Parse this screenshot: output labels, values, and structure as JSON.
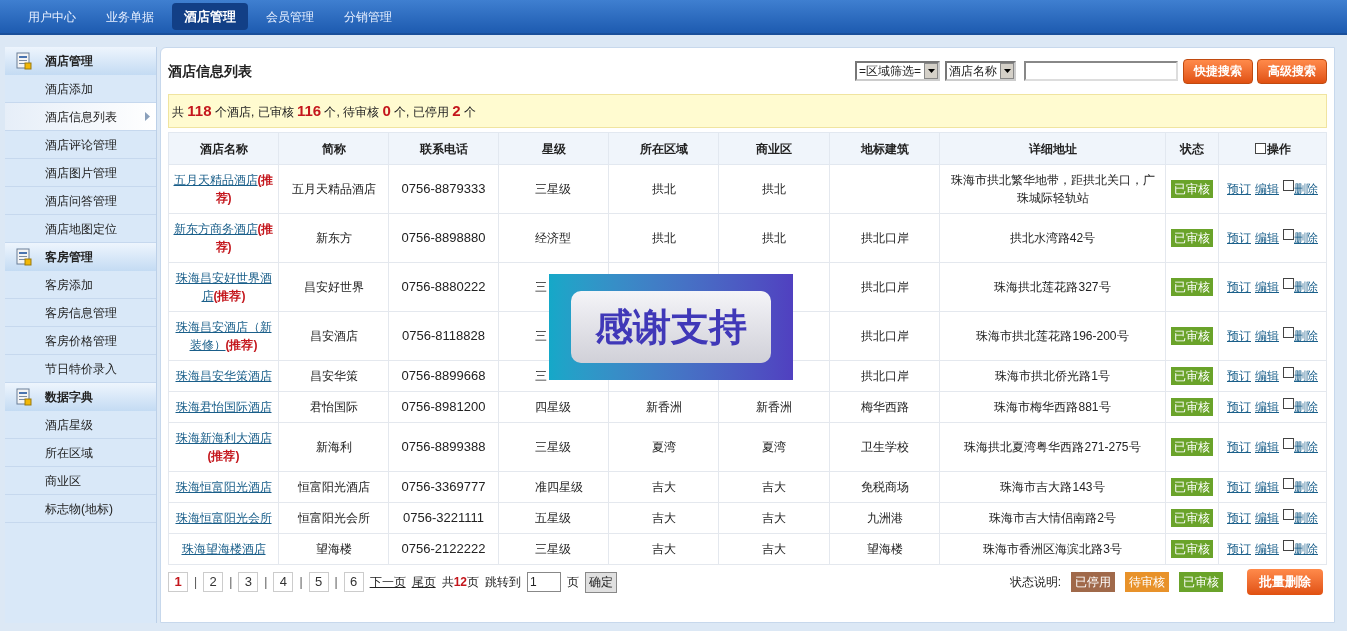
{
  "nav": [
    {
      "label": "用户中心",
      "selected": false
    },
    {
      "label": "业务单据",
      "selected": false
    },
    {
      "label": "酒店管理",
      "selected": true
    },
    {
      "label": "会员管理",
      "selected": false
    },
    {
      "label": "分销管理",
      "selected": false
    }
  ],
  "sidebar": [
    {
      "title": "酒店管理",
      "items": [
        {
          "label": "酒店添加",
          "selected": false
        },
        {
          "label": "酒店信息列表",
          "selected": true
        },
        {
          "label": "酒店评论管理",
          "selected": false
        },
        {
          "label": "酒店图片管理",
          "selected": false
        },
        {
          "label": "酒店问答管理",
          "selected": false
        },
        {
          "label": "酒店地图定位",
          "selected": false
        }
      ]
    },
    {
      "title": "客房管理",
      "items": [
        {
          "label": "客房添加",
          "selected": false
        },
        {
          "label": "客房信息管理",
          "selected": false
        },
        {
          "label": "客房价格管理",
          "selected": false
        },
        {
          "label": "节日特价录入",
          "selected": false
        }
      ]
    },
    {
      "title": "数据字典",
      "items": [
        {
          "label": "酒店星级",
          "selected": false
        },
        {
          "label": "所在区域",
          "selected": false
        },
        {
          "label": "商业区",
          "selected": false
        },
        {
          "label": "标志物(地标)",
          "selected": false
        }
      ]
    }
  ],
  "panel_title": "酒店信息列表",
  "filters": [
    {
      "value": "=区域筛选="
    },
    {
      "value": "酒店名称"
    }
  ],
  "search_buttons": [
    "快捷搜索",
    "高级搜索"
  ],
  "summary": "共 **118** 个酒店, 已审核 **116** 个, 待审核 **0** 个, 已停用 **2** 个",
  "table": {
    "columns": [
      "酒店名称",
      "简称",
      "联系电话",
      "星级",
      "所在区域",
      "商业区",
      "地标建筑",
      "详细地址",
      "状态",
      "操作"
    ],
    "select_all_checked": false,
    "rows": [
      {
        "name": "五月天精品酒店",
        "tag": "(推荐)",
        "short": "五月天精品酒店",
        "phone": "0756-8879333",
        "star": "三星级",
        "region": "拱北",
        "biz": "拱北",
        "address": "珠海市拱北繁华地带，距拱北关口，广珠城际轻轨站",
        "status": {
          "label": "已审核",
          "kind": "approved"
        },
        "actions": [
          "预订",
          "编辑",
          "删除"
        ],
        "checked": false
      },
      {
        "name": "新东方商务酒店",
        "tag": "(推荐)",
        "short": "新东方",
        "phone": "0756-8898880",
        "star": "经济型",
        "region": "拱北",
        "biz": "拱北",
        "landmark": "拱北口岸",
        "address": "拱北水湾路42号",
        "status": {
          "label": "已审核",
          "kind": "approved"
        },
        "actions": [
          "预订",
          "编辑",
          "删除"
        ],
        "checked": false
      },
      {
        "name": "珠海昌安好世界酒店",
        "tag": "(推荐)",
        "short": "昌安好世界",
        "phone": "0756-8880222",
        "star": "三",
        "landmark": "拱北口岸",
        "address": "珠海拱北莲花路327号",
        "status": {
          "label": "已审核",
          "kind": "approved"
        },
        "actions": [
          "预订",
          "编辑",
          "删除"
        ],
        "checked": false
      },
      {
        "name": "珠海昌安酒店（新装修）",
        "tag": "(推荐)",
        "short": "昌安酒店",
        "phone": "0756-8118828",
        "star": "三",
        "landmark": "拱北口岸",
        "address": "珠海市拱北莲花路196-200号",
        "status": {
          "label": "已审核",
          "kind": "approved"
        },
        "actions": [
          "预订",
          "编辑",
          "删除"
        ],
        "checked": false
      },
      {
        "name": "珠海昌安华策酒店",
        "short": "昌安华策",
        "phone": "0756-8899668",
        "star": "三",
        "landmark": "拱北口岸",
        "address": "珠海市拱北侨光路1号",
        "status": {
          "label": "已审核",
          "kind": "approved"
        },
        "actions": [
          "预订",
          "编辑",
          "删除"
        ],
        "checked": false
      },
      {
        "name": "珠海君怡国际酒店",
        "short": "君怡国际",
        "phone": "0756-8981200",
        "star": "四星级",
        "region": "新香洲",
        "biz": "新香洲",
        "landmark": "梅华西路",
        "address": "珠海市梅华西路881号",
        "status": {
          "label": "已审核",
          "kind": "approved"
        },
        "actions": [
          "预订",
          "编辑",
          "删除"
        ],
        "checked": false
      },
      {
        "name": "珠海新海利大酒店",
        "tag": "(推荐)",
        "short": "新海利",
        "phone": "0756-8899388",
        "star": "三星级",
        "region": "夏湾",
        "biz": "夏湾",
        "landmark": "卫生学校",
        "address": "珠海拱北夏湾粤华西路271-275号",
        "status": {
          "label": "已审核",
          "kind": "approved"
        },
        "actions": [
          "预订",
          "编辑",
          "删除"
        ],
        "checked": false
      },
      {
        "name": "珠海恒富阳光酒店",
        "short": "恒富阳光酒店",
        "phone": "0756-3369777",
        "star": "准四星级",
        "region": "吉大",
        "biz": "吉大",
        "landmark": "免税商场",
        "address": "珠海市吉大路143号",
        "status": {
          "label": "已审核",
          "kind": "approved"
        },
        "actions": [
          "预订",
          "编辑",
          "删除"
        ],
        "checked": false
      },
      {
        "name": "珠海恒富阳光会所",
        "short": "恒富阳光会所",
        "phone": "0756-3221111",
        "star": "五星级",
        "region": "吉大",
        "biz": "吉大",
        "landmark": "九洲港",
        "address": "珠海市吉大情侣南路2号",
        "status": {
          "label": "已审核",
          "kind": "approved"
        },
        "actions": [
          "预订",
          "编辑",
          "删除"
        ],
        "checked": false
      },
      {
        "name": "珠海望海楼酒店",
        "short": "望海楼",
        "phone": "0756-2122222",
        "star": "三星级",
        "region": "吉大",
        "biz": "吉大",
        "landmark": "望海楼",
        "address": "珠海市香洲区海滨北路3号",
        "status": {
          "label": "已审核",
          "kind": "approved"
        },
        "actions": [
          "预订",
          "编辑",
          "删除"
        ],
        "checked": false
      }
    ]
  },
  "pagination": {
    "pages": [
      {
        "label": "1",
        "selected": true
      },
      {
        "label": "2",
        "selected": false
      },
      {
        "label": "3",
        "selected": false
      },
      {
        "label": "4",
        "selected": false
      },
      {
        "label": "5",
        "selected": false
      },
      {
        "label": "6",
        "selected": false
      }
    ],
    "separator": "|",
    "next": "下一页",
    "last": "尾页",
    "total": "共**12**页",
    "jump_label": "跳转到",
    "jump_value": "1",
    "jump_unit": "页",
    "go": "确定"
  },
  "legend": {
    "label": "状态说明:",
    "items": [
      {
        "label": "已停用",
        "kind": "disabled"
      },
      {
        "label": "待审核",
        "kind": "pending"
      },
      {
        "label": "已审核",
        "kind": "approved"
      }
    ]
  },
  "batch_delete": "批量删除",
  "overlay": {
    "text": "感谢支持"
  }
}
